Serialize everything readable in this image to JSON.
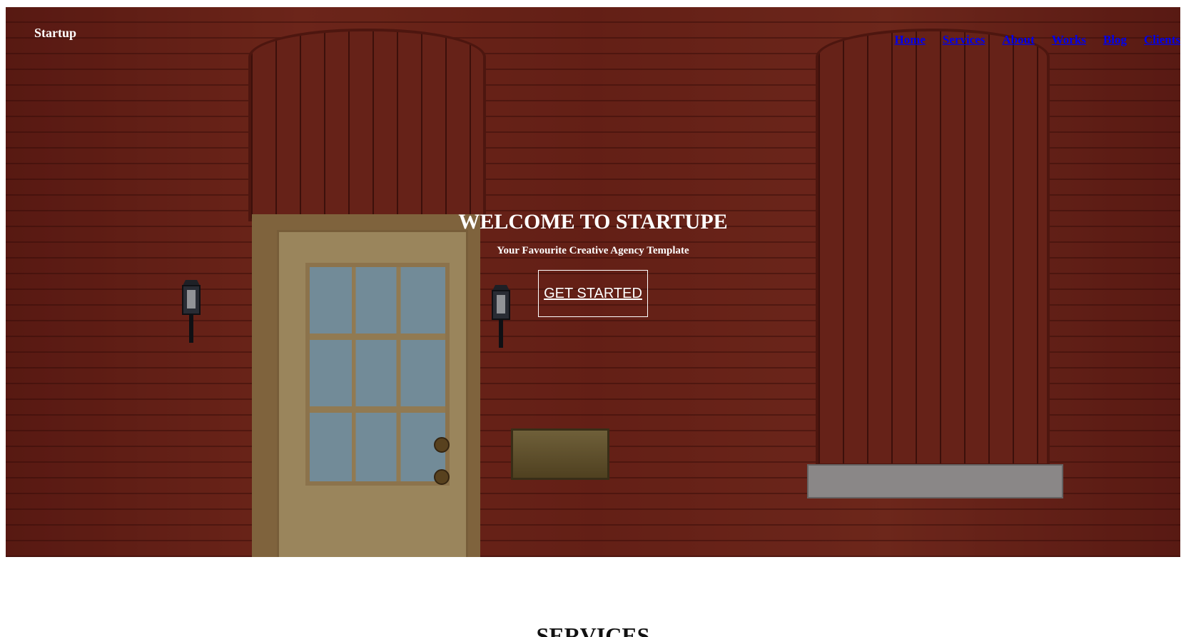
{
  "brand": {
    "name": "Startup"
  },
  "nav": {
    "items": [
      {
        "label": "Home"
      },
      {
        "label": "Services"
      },
      {
        "label": "About"
      },
      {
        "label": "Works"
      },
      {
        "label": "Blog"
      },
      {
        "label": "Clients"
      }
    ]
  },
  "hero": {
    "title": "WELCOME TO STARTUPE",
    "subtitle": "Your Favourite Creative Agency Template",
    "cta_label": "GET STARTED"
  },
  "services": {
    "title": "SERVICES"
  },
  "colors": {
    "link": "#0000ee",
    "hero_text": "#ffffff",
    "brick": "#8f2a1f"
  }
}
